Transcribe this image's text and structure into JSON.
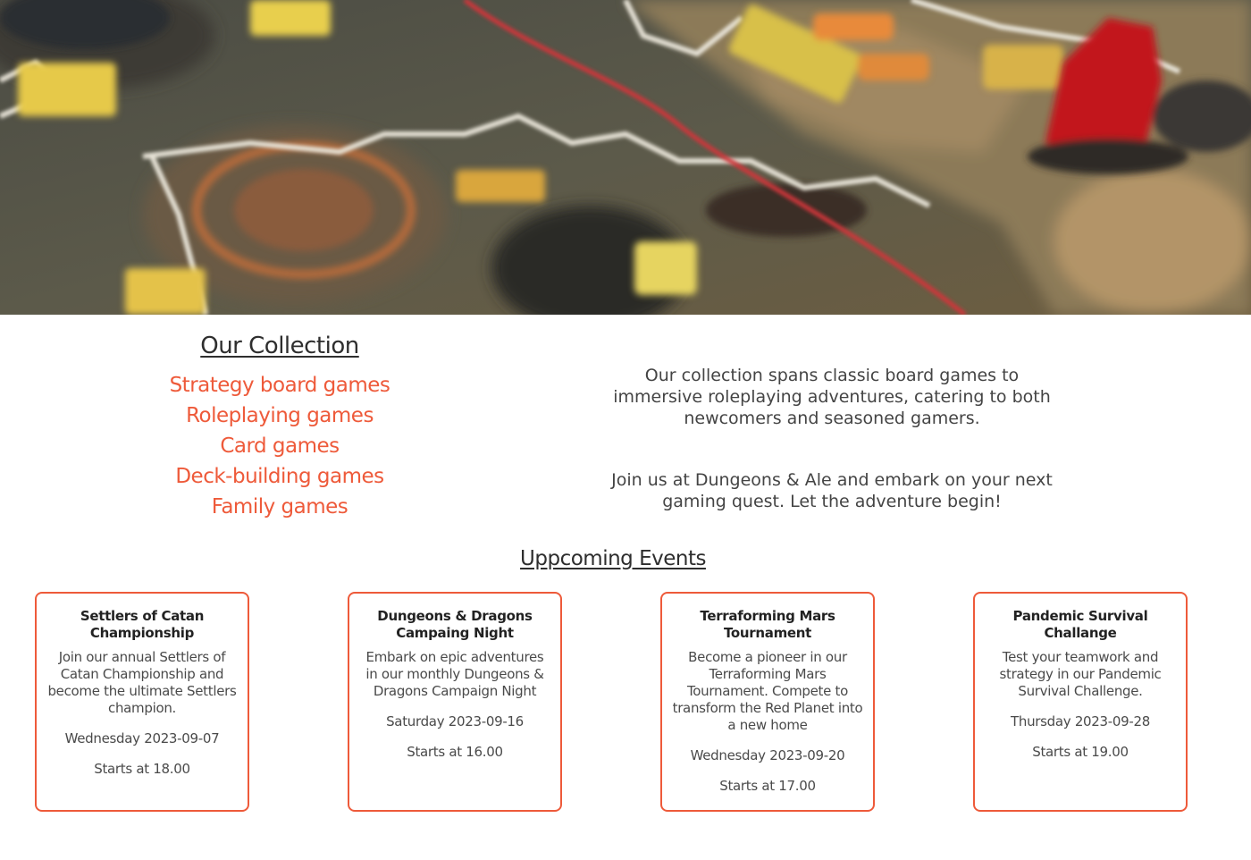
{
  "collection": {
    "title": "Our Collection",
    "items": [
      "Strategy board games",
      "Roleplaying games",
      "Card games",
      "Deck-building games",
      "Family games"
    ]
  },
  "intro": {
    "paragraph_1": "Our collection spans classic board games to immersive roleplaying adventures, catering to both newcomers and seasoned gamers.",
    "paragraph_2": "Join us at Dungeons & Ale and embark on your next gaming quest. Let the adventure begin!"
  },
  "events": {
    "title": "Uppcoming Events",
    "items": [
      {
        "title": "Settlers of Catan Championship",
        "description": "Join our annual Settlers of Catan Championship and become the ultimate Settlers champion.",
        "date": "Wednesday 2023-09-07",
        "time": "Starts at 18.00"
      },
      {
        "title": "Dungeons & Dragons Campaing Night",
        "description": "Embark on epic adventures in our monthly Dungeons & Dragons Campaign Night",
        "date": "Saturday 2023-09-16",
        "time": "Starts at 16.00"
      },
      {
        "title": "Terraforming Mars Tournament",
        "description": "Become a pioneer in our Terraforming Mars Tournament. Compete to transform the Red Planet into a new home",
        "date": "Wednesday 2023-09-20",
        "time": "Starts at 17.00"
      },
      {
        "title": "Pandemic Survival Challange",
        "description": "Test your teamwork and strategy in our Pandemic Survival Challenge.",
        "date": "Thursday 2023-09-28",
        "time": "Starts at 19.00"
      }
    ]
  },
  "colors": {
    "accent": "#ee5a3a",
    "text": "#333333",
    "background": "#ffffff"
  },
  "hero": {
    "icon": "board-game-photo"
  }
}
